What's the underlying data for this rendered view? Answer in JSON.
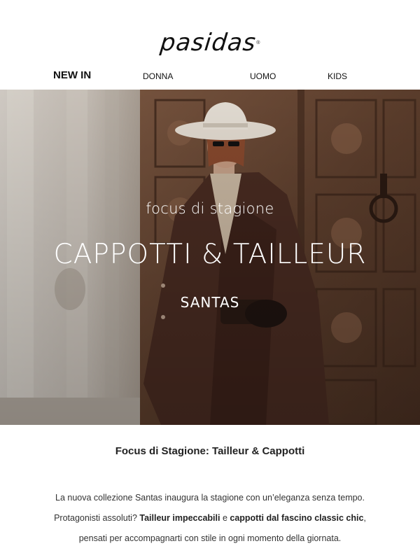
{
  "brand": {
    "logo_text": "pasidas",
    "logo_mark": "®"
  },
  "nav": {
    "items": [
      {
        "label": "NEW IN"
      },
      {
        "label": "DONNA"
      },
      {
        "label": "UOMO"
      },
      {
        "label": "KIDS"
      }
    ]
  },
  "hero": {
    "subtitle": "focus di stagione",
    "title": "CAPPOTTI & TAILLEUR",
    "brand": "SANTAS"
  },
  "section": {
    "title": "Focus di Stagione: Tailleur & Cappotti"
  },
  "body": {
    "line1": "La nuova collezione Santas inaugura la stagione con un’eleganza senza tempo.",
    "line2_prefix": "Protagonisti assoluti? ",
    "line2_bold1": "Tailleur impeccabili",
    "line2_mid": " e ",
    "line2_bold2": "cappotti dal fascino classic chic",
    "line2_suffix": ",",
    "line3": "pensati per accompagnarti con stile in ogni momento della giornata."
  },
  "colors": {
    "background": "#ffffff",
    "text": "#222222",
    "door_wood": "#6b4a36",
    "coat": "#4a2c22",
    "hat": "#e9e1d6"
  }
}
